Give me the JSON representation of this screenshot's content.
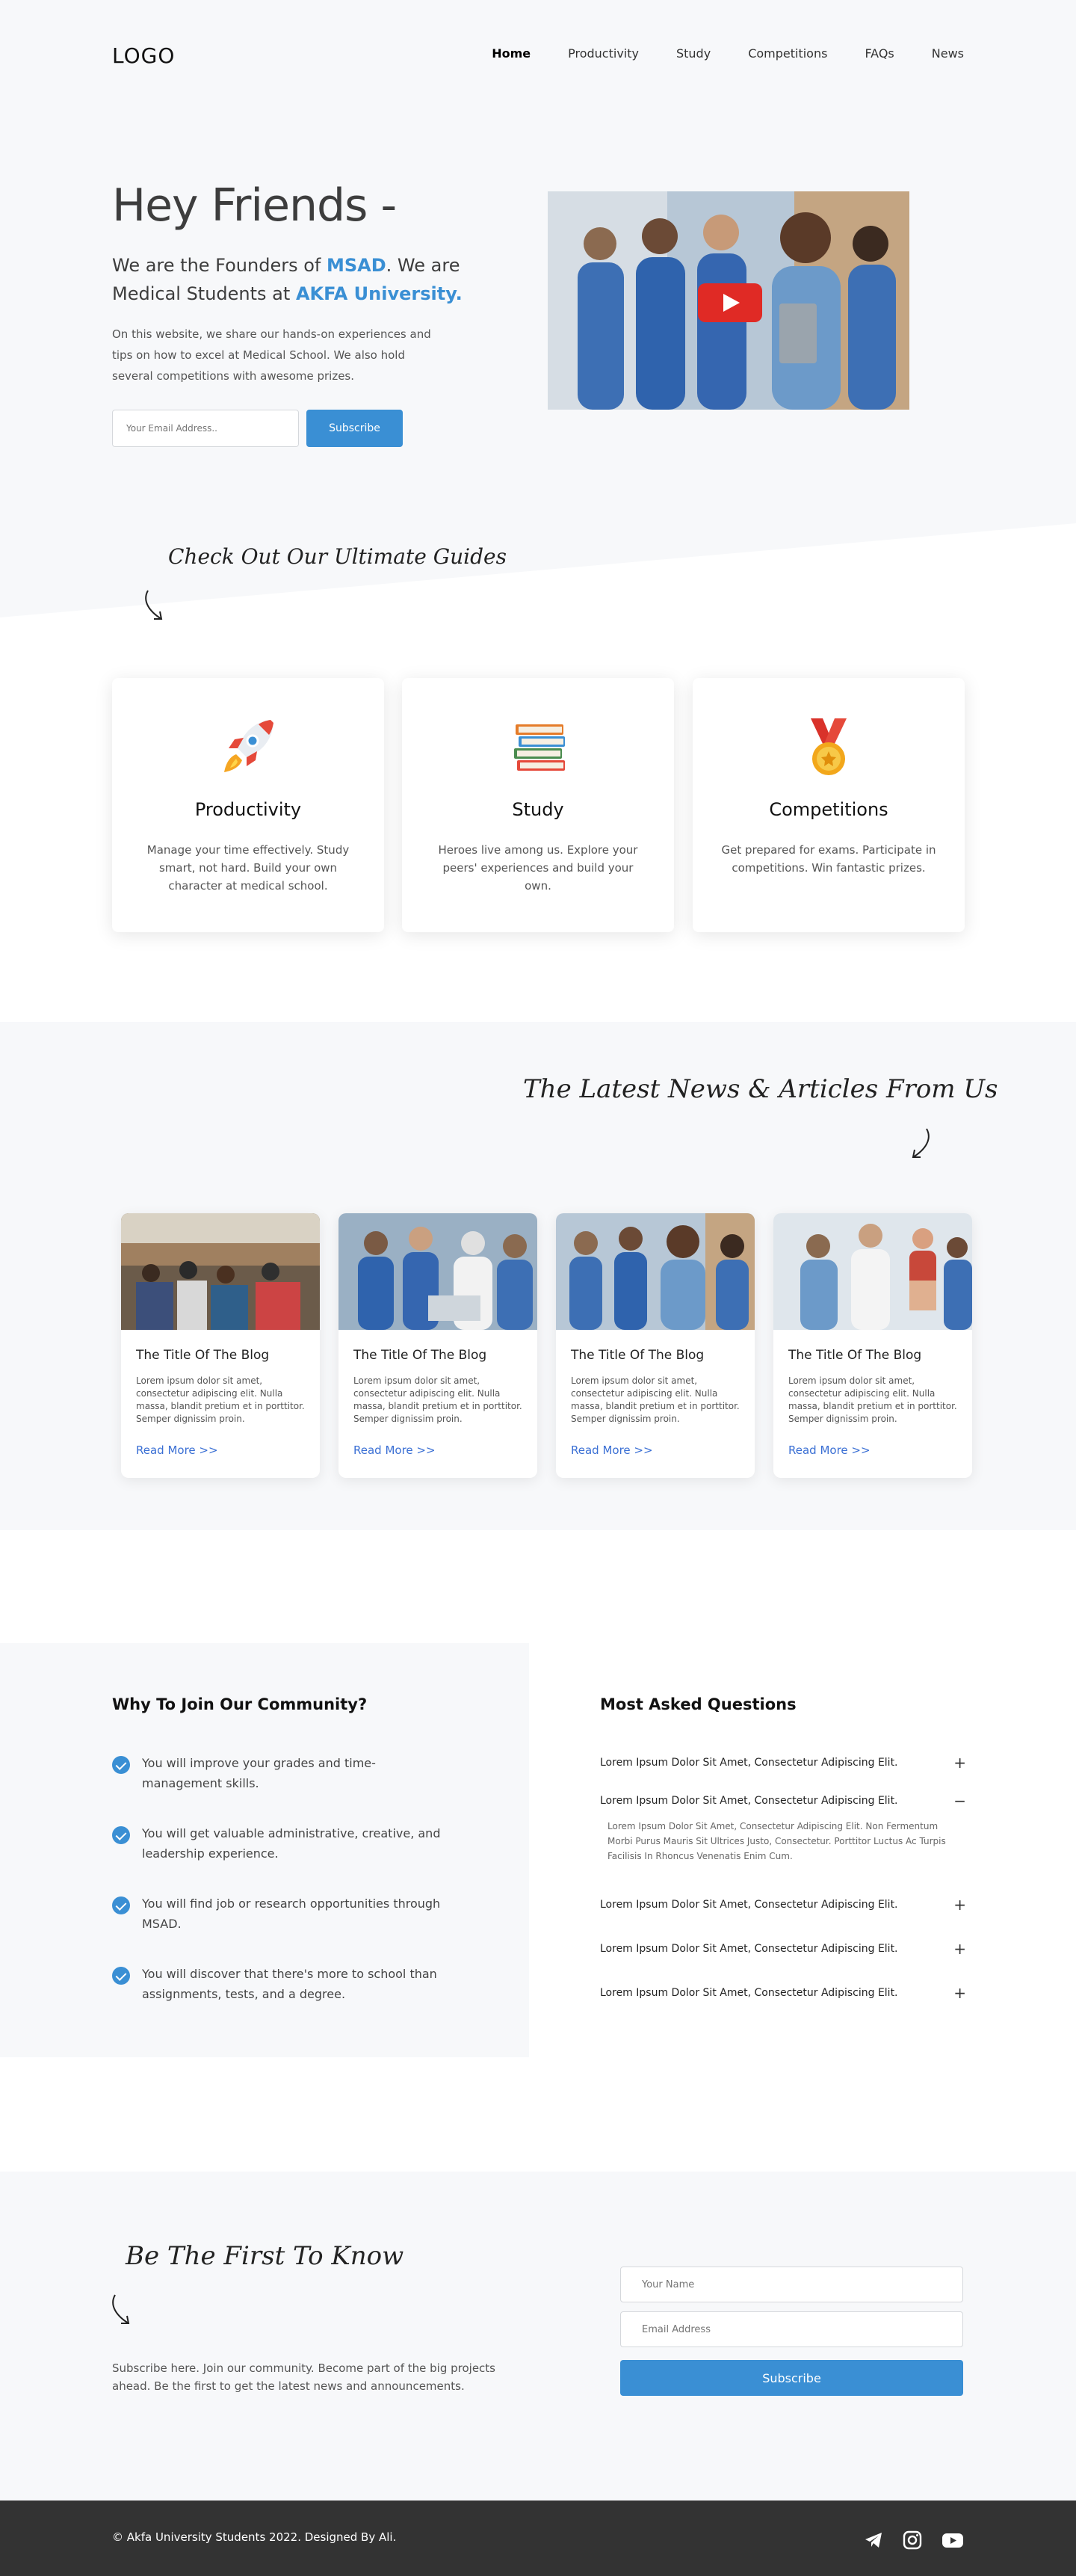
{
  "header": {
    "logo": "LOGO",
    "nav": [
      "Home",
      "Productivity",
      "Study",
      "Competitions",
      "FAQs",
      "News"
    ]
  },
  "hero": {
    "title": "Hey Friends -",
    "sub_part1": "We are the Founders of ",
    "sub_hl1": "MSAD",
    "sub_part2": ". We are Medical Students at ",
    "sub_hl2": "AKFA University.",
    "description": "On this website, we share our hands-on experiences and tips on how to excel at Medical School. We also hold several competitions with awesome prizes.",
    "email_placeholder": "Your Email Address..",
    "subscribe_label": "Subscribe"
  },
  "guides": {
    "title": "Check Out Our Ultimate Guides",
    "cards": [
      {
        "title": "Productivity",
        "text": "Manage your time effectively. Study smart, not hard. Build your own character at medical school.",
        "icon": "rocket-icon"
      },
      {
        "title": "Study",
        "text": "Heroes live among us. Explore your peers' experiences and build your own.",
        "icon": "books-icon"
      },
      {
        "title": "Competitions",
        "text": "Get prepared for exams. Participate in competitions. Win fantastic prizes.",
        "icon": "medal-icon"
      }
    ]
  },
  "news": {
    "title": "The Latest News & Articles From Us",
    "posts": [
      {
        "title": "The Title Of The Blog",
        "excerpt": "Lorem ipsum dolor sit amet, consectetur adipiscing elit. Nulla massa, blandit pretium et in porttitor. Semper dignissim proin.",
        "link": "Read More >>"
      },
      {
        "title": "The Title Of The Blog",
        "excerpt": "Lorem ipsum dolor sit amet, consectetur adipiscing elit. Nulla massa, blandit pretium et in porttitor. Semper dignissim proin.",
        "link": "Read More >>"
      },
      {
        "title": "The Title Of The Blog",
        "excerpt": "Lorem ipsum dolor sit amet, consectetur adipiscing elit. Nulla massa, blandit pretium et in porttitor. Semper dignissim proin.",
        "link": "Read More >>"
      },
      {
        "title": "The Title Of The Blog",
        "excerpt": "Lorem ipsum dolor sit amet, consectetur adipiscing elit. Nulla massa, blandit pretium et in porttitor. Semper dignissim proin.",
        "link": "Read More >>"
      }
    ]
  },
  "community": {
    "title": "Why To Join Our Community?",
    "reasons": [
      "You will improve your grades and time-management skills.",
      "You will get valuable administrative, creative, and leadership experience.",
      "You will find job or research opportunities through MSAD.",
      "You will discover that there's more to school than assignments, tests, and a degree."
    ]
  },
  "faq": {
    "title": "Most Asked Questions",
    "items": [
      {
        "q": "Lorem Ipsum Dolor Sit Amet, Consectetur Adipiscing Elit.",
        "toggle": "+"
      },
      {
        "q": "Lorem Ipsum Dolor Sit Amet, Consectetur Adipiscing Elit.",
        "toggle": "−"
      },
      {
        "q": "Lorem Ipsum Dolor Sit Amet, Consectetur Adipiscing Elit.",
        "toggle": "+"
      },
      {
        "q": "Lorem Ipsum Dolor Sit Amet, Consectetur Adipiscing Elit.",
        "toggle": "+"
      },
      {
        "q": "Lorem Ipsum Dolor Sit Amet, Consectetur Adipiscing Elit.",
        "toggle": "+"
      }
    ],
    "open_answer": "Lorem Ipsum Dolor Sit Amet, Consectetur Adipiscing Elit. Non Fermentum Morbi Purus Mauris Sit Ultrices Justo, Consectetur. Porttitor Luctus Ac Turpis Facilisis In Rhoncus Venenatis Enim Cum."
  },
  "subscribe": {
    "title": "Be The First To Know",
    "text": "Subscribe here. Join our community. Become part of the big projects ahead. Be the first to get the latest news and announcements.",
    "name_placeholder": "Your Name",
    "email_placeholder": "Email Address",
    "button": "Subscribe"
  },
  "footer": {
    "copyright": "© Akfa University Students 2022. Designed By Ali.",
    "social": [
      "telegram-icon",
      "instagram-icon",
      "youtube-icon"
    ]
  },
  "colors": {
    "accent": "#3a8fd4",
    "link": "#3a6fd4",
    "footer": "#333333",
    "section_bg": "#f7f8fa"
  }
}
